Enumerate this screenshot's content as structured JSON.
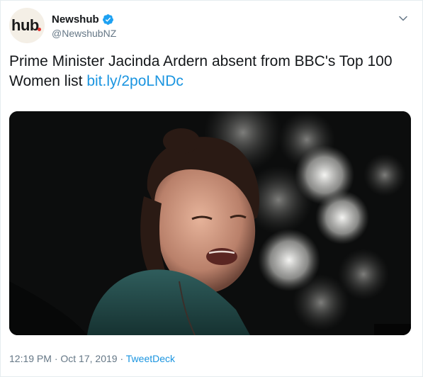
{
  "account": {
    "avatar_text": "hub",
    "display_name": "Newshub",
    "handle": "@NewshubNZ",
    "verified": true
  },
  "tweet": {
    "text": "Prime Minister Jacinda Ardern absent from BBC's Top 100 Women list",
    "link_text": "bit.ly/2poLNDc"
  },
  "meta": {
    "time": "12:19 PM",
    "separator_1": "·",
    "date": "Oct 17, 2019",
    "separator_2": "·",
    "source": "TweetDeck"
  },
  "colors": {
    "link": "#1b95e0",
    "verified": "#1da1f2",
    "muted": "#657786"
  },
  "icons": {
    "verified": "verified-badge-icon",
    "menu": "chevron-down-icon"
  }
}
